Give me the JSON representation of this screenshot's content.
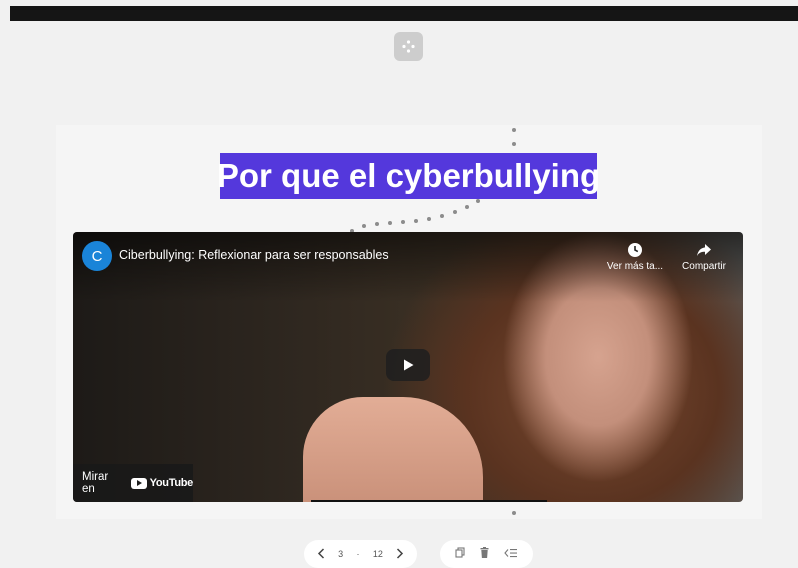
{
  "slide": {
    "title": "Por que el cyberbullying"
  },
  "video": {
    "channel_initial": "C",
    "title": "Ciberbullying: Reflexionar para ser responsables",
    "watch_later_label": "Ver más ta...",
    "share_label": "Compartir",
    "watch_on_label": "Mirar en",
    "youtube_label": "YouTube"
  },
  "pager": {
    "current": "3",
    "separator": "·",
    "total": "12"
  },
  "icons": {
    "move": "move-icon",
    "prev": "chevron-left-icon",
    "next": "chevron-right-icon",
    "duplicate": "copy-icon",
    "delete": "trash-icon",
    "order": "list-order-icon"
  },
  "colors": {
    "title_bg": "#5438dc",
    "title_fg": "#ffffff",
    "channel_avatar": "#1a84d8"
  }
}
